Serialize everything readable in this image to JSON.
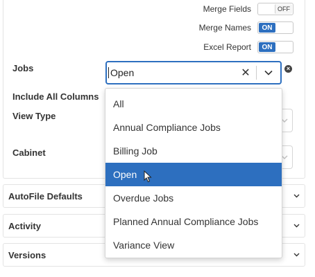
{
  "toggles": [
    {
      "label": "Merge Fields",
      "state": "OFF"
    },
    {
      "label": "Merge Names",
      "state": "ON"
    },
    {
      "label": "Excel Report",
      "state": "ON"
    }
  ],
  "fields": {
    "jobs_label": "Jobs",
    "include_all_columns_label": "Include All Columns",
    "view_type_label": "View Type",
    "cabinet_label": "Cabinet"
  },
  "jobs_select": {
    "value": "Open",
    "clear_glyph": "✕",
    "options": [
      {
        "label": "All",
        "selected": false
      },
      {
        "label": "Annual Compliance Jobs",
        "selected": false
      },
      {
        "label": "Billing Job",
        "selected": false
      },
      {
        "label": "Open",
        "selected": true
      },
      {
        "label": "Overdue Jobs",
        "selected": false
      },
      {
        "label": "Planned Annual Compliance Jobs",
        "selected": false
      },
      {
        "label": "Variance View",
        "selected": false
      }
    ]
  },
  "accordions": {
    "autofile": "AutoFile Defaults",
    "activity": "Activity",
    "versions": "Versions"
  },
  "colors": {
    "accent": "#2d6fbf",
    "border": "#e3e3e3"
  },
  "icons": {
    "clear": "close-icon",
    "dropdown": "chevron-down-icon",
    "remove": "remove-circle-icon",
    "pointer": "mouse-cursor-icon"
  }
}
